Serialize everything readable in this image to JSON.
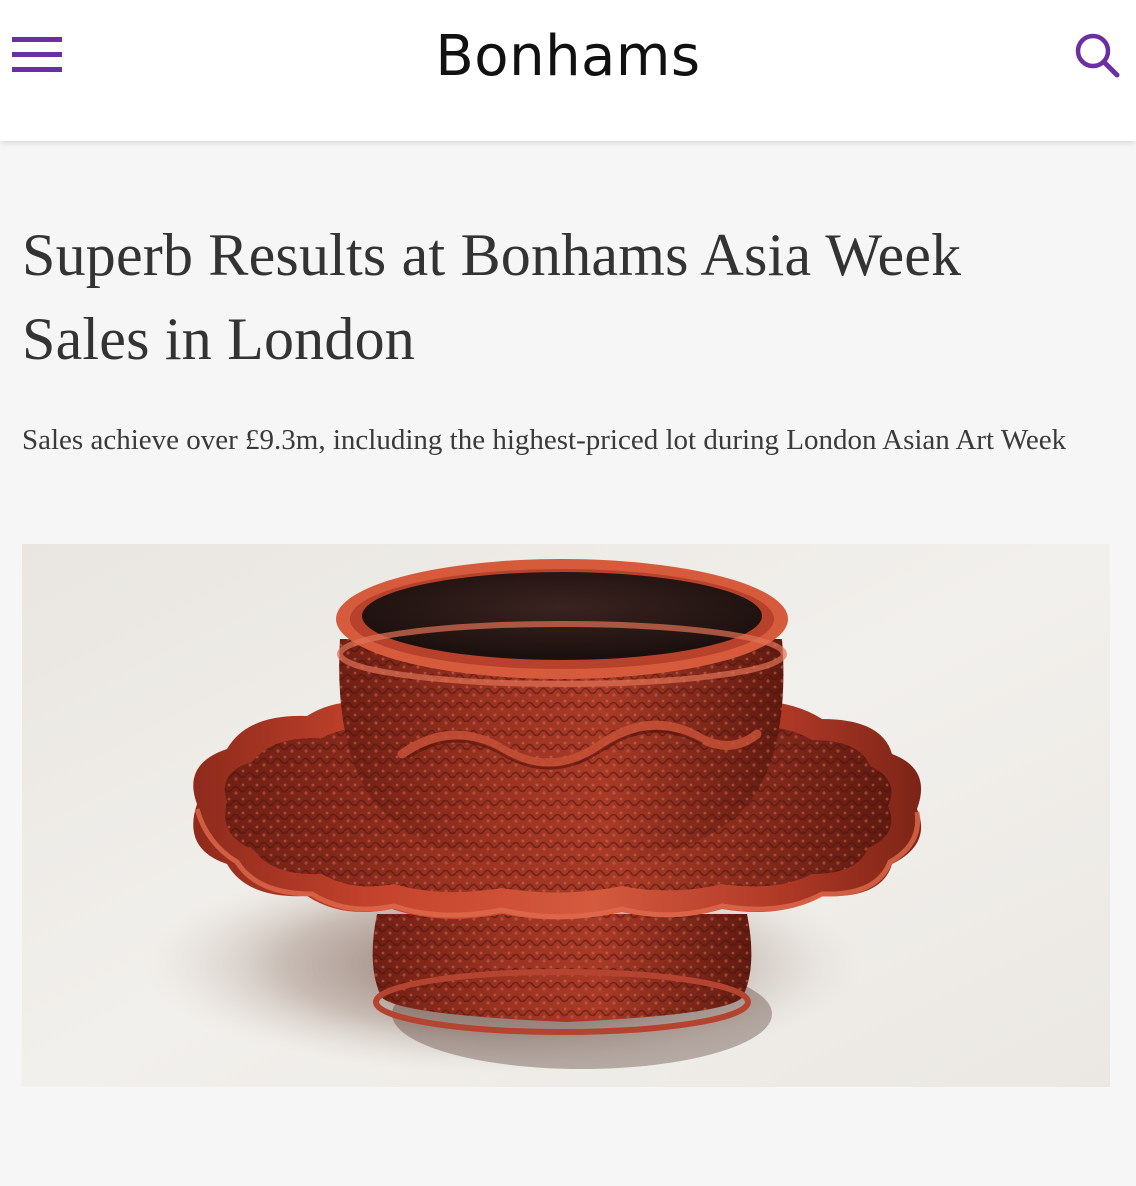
{
  "header": {
    "logo_text": "Bonhams",
    "menu_icon": "hamburger-menu-icon",
    "search_icon": "search-icon"
  },
  "article": {
    "title": "Superb Results at Bonhams Asia Week Sales in London",
    "subtitle": "Sales achieve over £9.3m, including the highest-priced lot during London Asian Art Week",
    "image_subject": "carved red lacquer cup and stand"
  },
  "colors": {
    "accent": "#6b2fa3",
    "page_background": "#f6f6f6",
    "header_background": "#ffffff",
    "lacquer_red": "#c9452e"
  }
}
